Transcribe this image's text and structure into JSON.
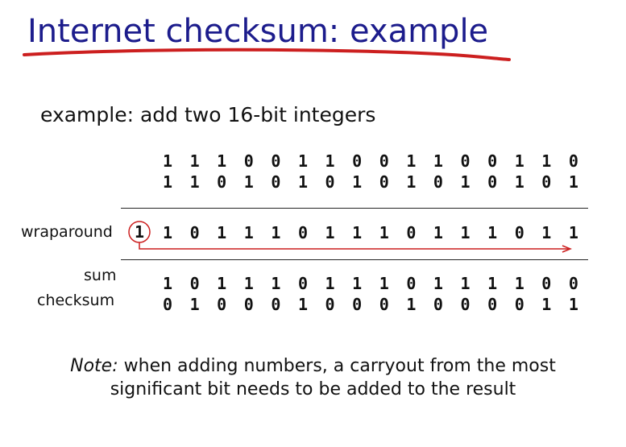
{
  "slide": {
    "title": "Internet checksum: example",
    "subtitle": "example: add two 16-bit integers",
    "rows": {
      "row1": [
        "1",
        "1",
        "1",
        "0",
        "0",
        "1",
        "1",
        "0",
        "0",
        "1",
        "1",
        "0",
        "0",
        "1",
        "1",
        "0"
      ],
      "row2": [
        "1",
        "1",
        "0",
        "1",
        "0",
        "1",
        "0",
        "1",
        "0",
        "1",
        "0",
        "1",
        "0",
        "1",
        "0",
        "1"
      ],
      "wraparound": [
        "1",
        "0",
        "1",
        "1",
        "1",
        "0",
        "1",
        "1",
        "1",
        "0",
        "1",
        "1",
        "1",
        "0",
        "1",
        "1"
      ],
      "sum": [
        "1",
        "0",
        "1",
        "1",
        "1",
        "0",
        "1",
        "1",
        "1",
        "0",
        "1",
        "1",
        "1",
        "1",
        "0",
        "0"
      ],
      "checksum": [
        "0",
        "1",
        "0",
        "0",
        "0",
        "1",
        "0",
        "0",
        "0",
        "1",
        "0",
        "0",
        "0",
        "0",
        "1",
        "1"
      ]
    },
    "carry_bit": "1",
    "labels": {
      "wraparound": "wraparound",
      "sum": "sum",
      "checksum": "checksum"
    },
    "note": {
      "prefix": "Note:",
      "line1_rest": " when adding numbers, a carryout from the most",
      "line2": "significant bit needs to be added to the result"
    },
    "colors": {
      "title": "#1c1c8c",
      "accent_red": "#cc1f1f"
    }
  }
}
